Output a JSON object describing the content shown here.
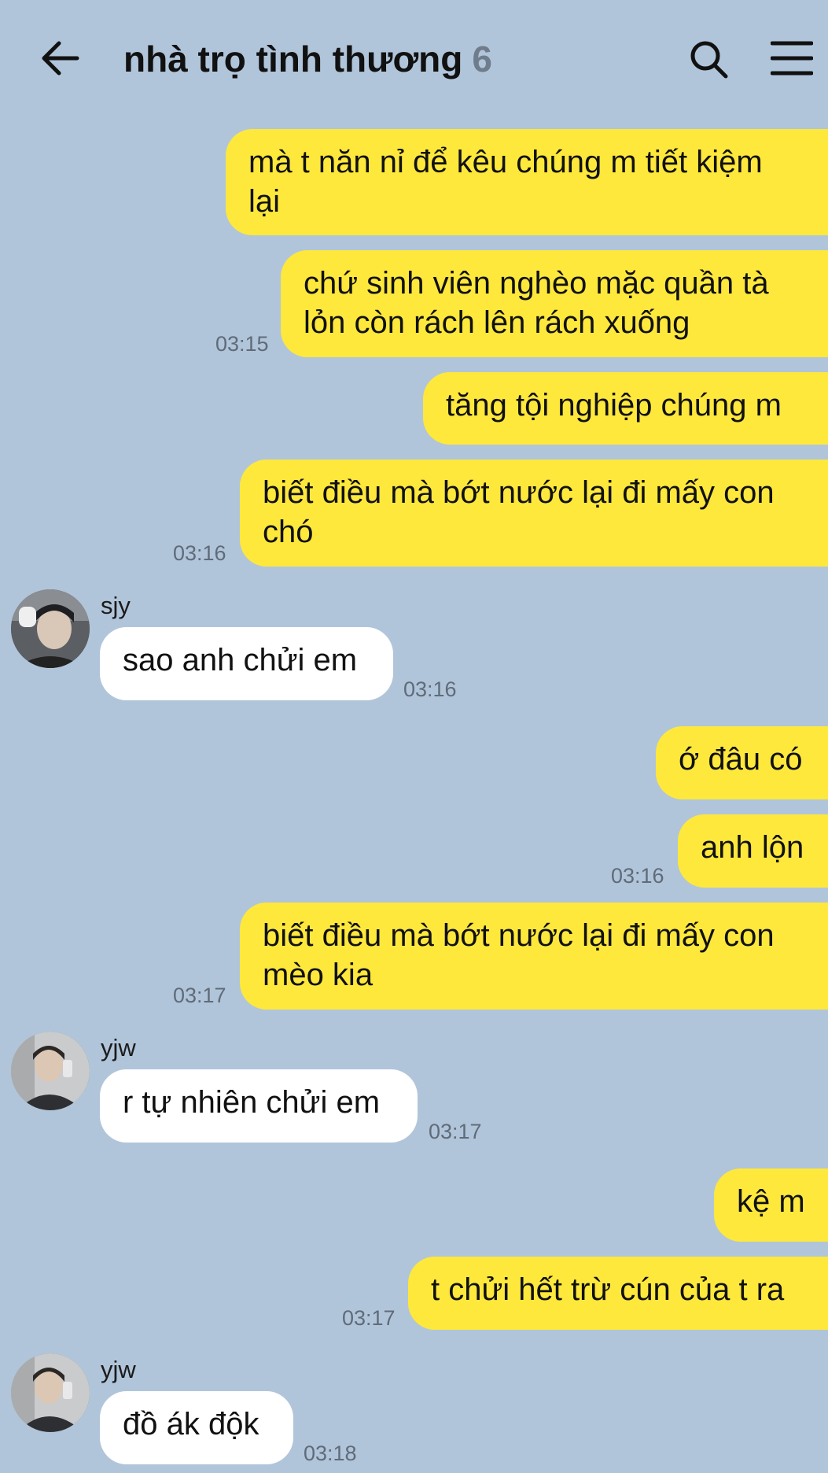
{
  "header": {
    "back_icon": "arrow-left-icon",
    "title": "nhà trọ tình thương",
    "member_count": "6",
    "search_icon": "search-icon",
    "menu_icon": "hamburger-menu-icon"
  },
  "colors": {
    "background": "#b1c5da",
    "outgoing_bubble": "#fee83c",
    "incoming_bubble": "#ffffff",
    "timestamp": "#5f6b79",
    "member_count": "#6f7c8b"
  },
  "messages": [
    {
      "id": "m1",
      "direction": "out",
      "text": "mà t năn nỉ để kêu chúng m tiết kiệm\nlại",
      "time": ""
    },
    {
      "id": "m2",
      "direction": "out",
      "text": "chứ sinh viên nghèo mặc quần tà\nlỏn còn rách lên rách xuống",
      "time": "03:15"
    },
    {
      "id": "m3",
      "direction": "out",
      "text": "tăng tội nghiệp chúng m",
      "time": ""
    },
    {
      "id": "m4",
      "direction": "out",
      "text": "biết điều mà bớt nước lại đi mấy con\nchó",
      "time": "03:16"
    },
    {
      "id": "m5",
      "direction": "in",
      "sender": "sjy",
      "text": "sao anh chửi em",
      "time": "03:16"
    },
    {
      "id": "m6",
      "direction": "out",
      "text": "ớ đâu có",
      "time": ""
    },
    {
      "id": "m7",
      "direction": "out",
      "text": "anh lộn",
      "time": "03:16"
    },
    {
      "id": "m8",
      "direction": "out",
      "text": "biết điều mà bớt nước lại đi mấy con\nmèo kia",
      "time": "03:17"
    },
    {
      "id": "m9",
      "direction": "in",
      "sender": "yjw",
      "text": "r tự nhiên chửi em",
      "time": "03:17"
    },
    {
      "id": "m10",
      "direction": "out",
      "text": "kệ m",
      "time": ""
    },
    {
      "id": "m11",
      "direction": "out",
      "text": "t chửi hết trừ cún của t ra",
      "time": "03:17"
    },
    {
      "id": "m12",
      "direction": "in",
      "sender": "yjw",
      "text": "đồ ák độk",
      "time": "03:18"
    }
  ]
}
